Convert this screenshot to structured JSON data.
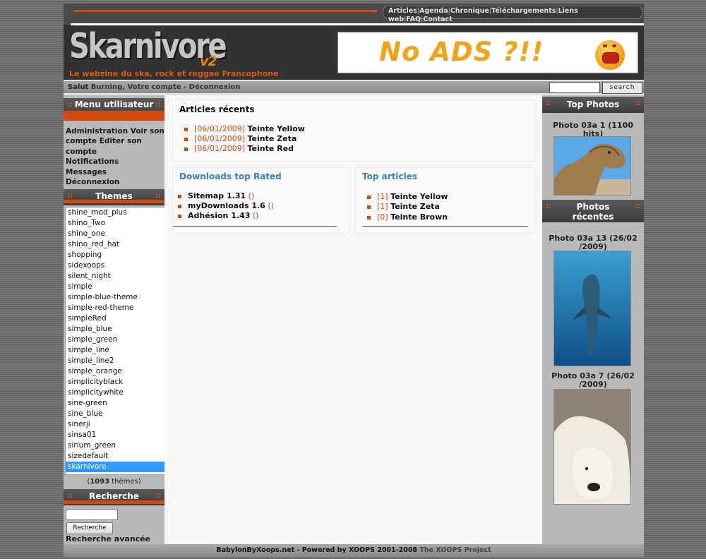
{
  "nav": {
    "items": [
      "Articles",
      "Agenda",
      "Chronique",
      "Téléchargements",
      "Liens web",
      "FAQ",
      "Contact"
    ]
  },
  "header": {
    "logo_text": "Skarnivore",
    "logo_version": "v2",
    "tagline": "Le webzine du ska, rock et reggae Francophone",
    "banner_text": "No ADS ?!!"
  },
  "userbar": {
    "greeting_prefix": "Salut",
    "greeting_name": "Burning, Votre compte",
    "separator": " - ",
    "logout": "Déconnexion",
    "search_button": "search"
  },
  "menu": {
    "title": "Menu utilisateur",
    "items": [
      "Administration",
      "Voir son compte",
      "Editer son compte",
      "Notifications",
      "Messages",
      "Déconnexion"
    ]
  },
  "themes": {
    "title": "Themes",
    "options": [
      "shine_mod_plus",
      "shino_Two",
      "shino_one",
      "shino_red_hat",
      "shopping",
      "sidexoops",
      "silent_night",
      "simple",
      "simple-blue-theme",
      "simple-red-theme",
      "simpleRed",
      "simple_blue",
      "simple_green",
      "simple_line",
      "simple_line2",
      "simple_orange",
      "simplicityblack",
      "simplicitywhite",
      "sine-green",
      "sine_blue",
      "sinerji",
      "sinsa01",
      "sirium_green",
      "sizedefault",
      "skarnivore"
    ],
    "selected": "skarnivore",
    "count_prefix": "(",
    "count": "1093",
    "count_suffix": " thèmes)"
  },
  "search": {
    "title": "Recherche",
    "button": "Recherche",
    "advanced": "Recherche avancée"
  },
  "recent_articles": {
    "title": "Articles récents",
    "items": [
      {
        "date": "[06/01/2009]",
        "title": "Teinte Yellow"
      },
      {
        "date": "[06/01/2009]",
        "title": "Teinte Zeta"
      },
      {
        "date": "[06/01/2009]",
        "title": "Teinte Red"
      }
    ]
  },
  "downloads_top": {
    "title": "Downloads top Rated",
    "items": [
      {
        "title": "Sitemap 1.31",
        "link": "()"
      },
      {
        "title": "myDownloads 1.6",
        "link": "()"
      },
      {
        "title": "Adhésion 1.43",
        "link": "()"
      }
    ]
  },
  "top_articles": {
    "title": "Top articles",
    "items": [
      {
        "count": "[1]",
        "title": "Teinte Yellow"
      },
      {
        "count": "[1]",
        "title": "Teinte Zeta"
      },
      {
        "count": "[0]",
        "title": "Teinte Brown"
      }
    ]
  },
  "top_photos": {
    "title": "Top Photos",
    "caption_line1": "Photo 03a 1 (1100",
    "caption_line2": "hits)"
  },
  "recent_photos": {
    "title_line1": "Photos",
    "title_line2": "récentes",
    "photo1_line1": "Photo 03a 13 (26/02",
    "photo1_line2": "/2009)",
    "photo2_line1": "Photo 03a 7 (26/02",
    "photo2_line2": "/2009)"
  },
  "footer": {
    "text": "BabylonByXoops.net - Powered by XOOPS 2001-2008",
    "project": "The XOOPS Project"
  },
  "colors": {
    "accent": "#d24a10",
    "link_blue": "#3b7fbf",
    "header_bg": "#323232"
  }
}
